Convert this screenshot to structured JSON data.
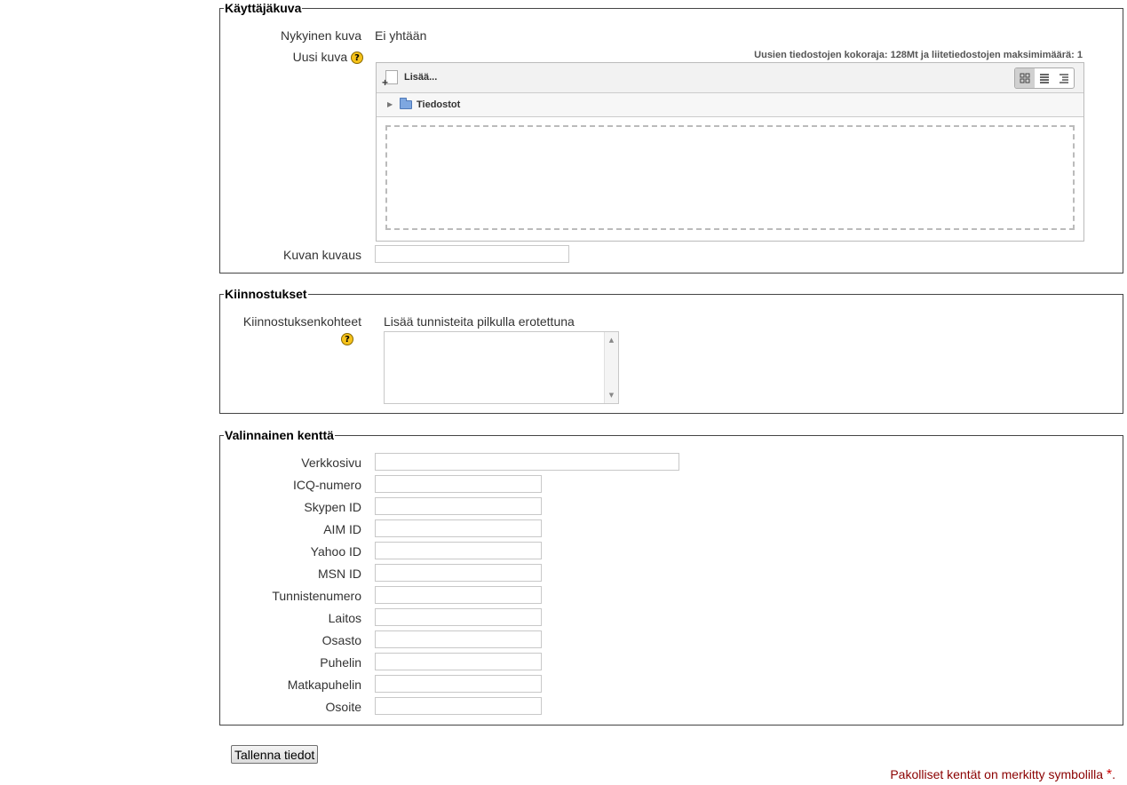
{
  "sections": {
    "user_picture": {
      "legend": "Käyttäjäkuva",
      "current_picture_label": "Nykyinen kuva",
      "current_picture_value": "Ei yhtään",
      "new_picture_label": "Uusi kuva",
      "file_limits": "Uusien tiedostojen kokoraja: 128Mt ja liitetiedostojen maksimimäärä: 1",
      "filemanager": {
        "add_label": "Lisää...",
        "folder_label": "Tiedostot",
        "views": [
          "icons-view",
          "list-view",
          "tree-view"
        ]
      },
      "description_label": "Kuvan kuvaus",
      "description_value": ""
    },
    "interests": {
      "legend": "Kiinnostukset",
      "label": "Kiinnostuksenkohteet",
      "hint": "Lisää tunnisteita pilkulla erotettuna",
      "value": ""
    },
    "optional": {
      "legend": "Valinnainen kenttä",
      "fields": [
        {
          "label": "Verkkosivu",
          "value": ""
        },
        {
          "label": "ICQ-numero",
          "value": ""
        },
        {
          "label": "Skypen ID",
          "value": ""
        },
        {
          "label": "AIM ID",
          "value": ""
        },
        {
          "label": "Yahoo ID",
          "value": ""
        },
        {
          "label": "MSN ID",
          "value": ""
        },
        {
          "label": "Tunnistenumero",
          "value": ""
        },
        {
          "label": "Laitos",
          "value": ""
        },
        {
          "label": "Osasto",
          "value": ""
        },
        {
          "label": "Puhelin",
          "value": ""
        },
        {
          "label": "Matkapuhelin",
          "value": ""
        },
        {
          "label": "Osoite",
          "value": ""
        }
      ]
    }
  },
  "submit_label": "Tallenna tiedot",
  "required_note": "Pakolliset kentät on merkitty symbolilla",
  "required_symbol": "*",
  "required_note_end": ".",
  "help_glyph": "?",
  "colors": {
    "help_icon": "#f6c21a",
    "required_text": "#8b0000",
    "required_star": "#cc0000"
  }
}
